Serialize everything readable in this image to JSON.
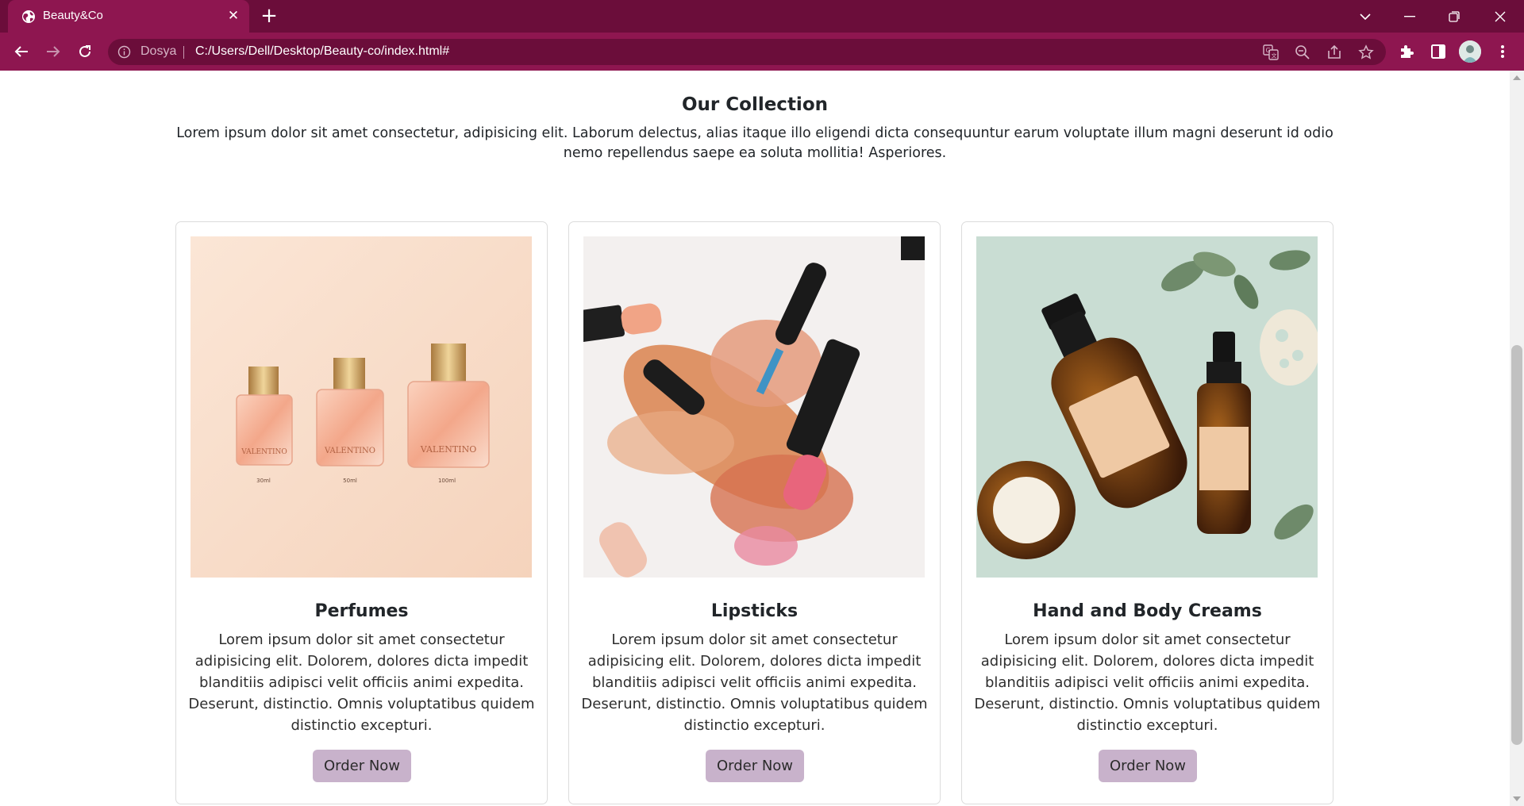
{
  "browser": {
    "tab_title": "Beauty&Co",
    "site_chip": "Dosya",
    "url": "C:/Users/Dell/Desktop/Beauty-co/index.html#",
    "theme_colors": {
      "tabbar": "#6b0d3a",
      "toolbar": "#8e1650"
    }
  },
  "collection": {
    "title": "Our Collection",
    "description": "Lorem ipsum dolor sit amet consectetur, adipisicing elit. Laborum delectus, alias itaque illo eligendi dicta consequuntur earum voluptate illum magni deserunt id odio nemo repellendus saepe ea soluta mollitia! Asperiores."
  },
  "cards": [
    {
      "title": "Perfumes",
      "text": "Lorem ipsum dolor sit amet consectetur adipisicing elit. Dolorem, dolores dicta impedit blanditiis adipisci velit officiis animi expedita. Deserunt, distinctio. Omnis voluptatibus quidem distinctio excepturi.",
      "button": "Order Now",
      "image": {
        "brand": "VALENTINO",
        "sizes": [
          "30ml",
          "50ml",
          "100ml"
        ]
      }
    },
    {
      "title": "Lipsticks",
      "text": "Lorem ipsum dolor sit amet consectetur adipisicing elit. Dolorem, dolores dicta impedit blanditiis adipisci velit officiis animi expedita. Deserunt, distinctio. Omnis voluptatibus quidem distinctio excepturi.",
      "button": "Order Now"
    },
    {
      "title": "Hand and Body Creams",
      "text": "Lorem ipsum dolor sit amet consectetur adipisicing elit. Dolorem, dolores dicta impedit blanditiis adipisci velit officiis animi expedita. Deserunt, distinctio. Omnis voluptatibus quidem distinctio excepturi.",
      "button": "Order Now"
    }
  ],
  "button_color": "#c8b2cb"
}
